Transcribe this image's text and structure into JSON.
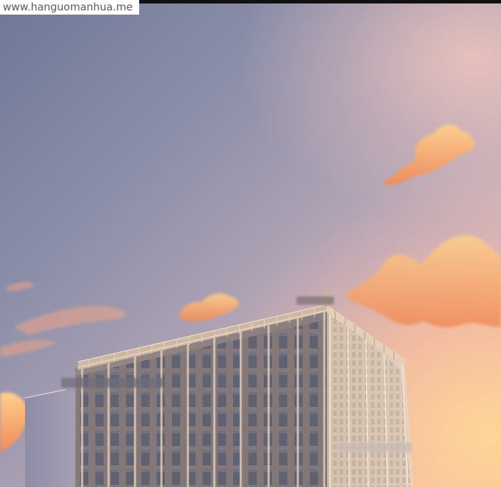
{
  "watermark": {
    "text": "www.hanguomanhua.me"
  },
  "scene": {
    "subject": "office-tower-at-sunset",
    "colors": {
      "sky_top": "#6f7896",
      "sky_glow": "#ffd696",
      "cloud": "#f5a36a",
      "cloud_highlight": "#ffcf8c",
      "building_face": "#8c7f7c",
      "building_side": "#b8a79c",
      "window": "#5f6170",
      "mullion": "#d8c3b0"
    }
  }
}
